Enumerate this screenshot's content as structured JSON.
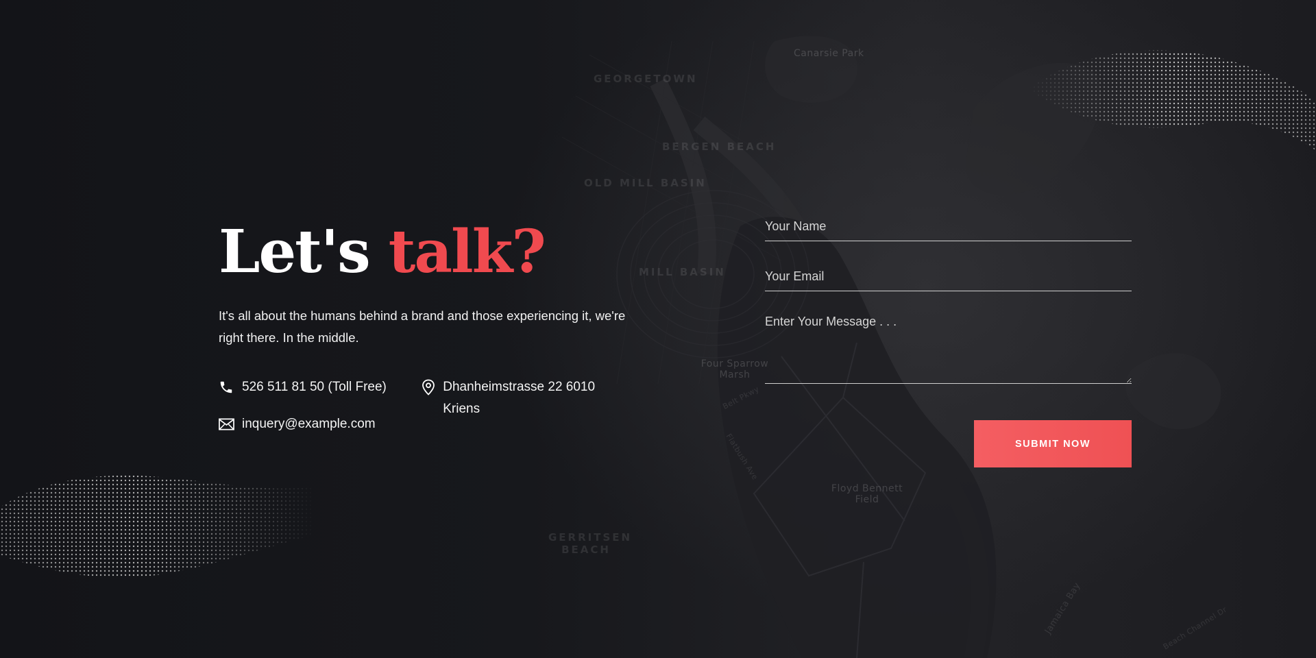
{
  "heading": {
    "part1": "Let's",
    "part2": "talk?"
  },
  "intro": "It's all about the humans behind a brand and those experiencing it, we're right there. In the middle.",
  "contact": {
    "phone": "526 511 81 50 (Toll Free)",
    "email": "inquery@example.com",
    "address": "Dhanheimstrasse 22 6010 Kriens"
  },
  "form": {
    "name_placeholder": "Your Name",
    "email_placeholder": "Your Email",
    "message_placeholder": "Enter Your Message . . .",
    "submit_label": "SUBMIT NOW"
  },
  "map_labels": {
    "canarsie_park": "Canarsie Park",
    "georgetown": "GEORGETOWN",
    "bergen_beach": "BERGEN BEACH",
    "old_mill_basin": "OLD MILL BASIN",
    "mill_basin": "MILL BASIN",
    "four_sparrow_marsh": "Four Sparrow Marsh",
    "floyd_bennett_field": "Floyd Bennett Field",
    "gerritsen_beach": "GERRITSEN BEACH",
    "belt_pkwy": "Belt Pkwy",
    "flatbush_ave": "Flatbush Ave",
    "jamaica_bay": "Jamaica Bay",
    "beach_channel_dr": "Beach Channel Dr"
  },
  "colors": {
    "background": "#141519",
    "accent": "#f04a4f",
    "button": "#f25a5d"
  },
  "icons": {
    "phone": "phone-icon",
    "email": "envelope-icon",
    "address": "map-pin-icon"
  }
}
